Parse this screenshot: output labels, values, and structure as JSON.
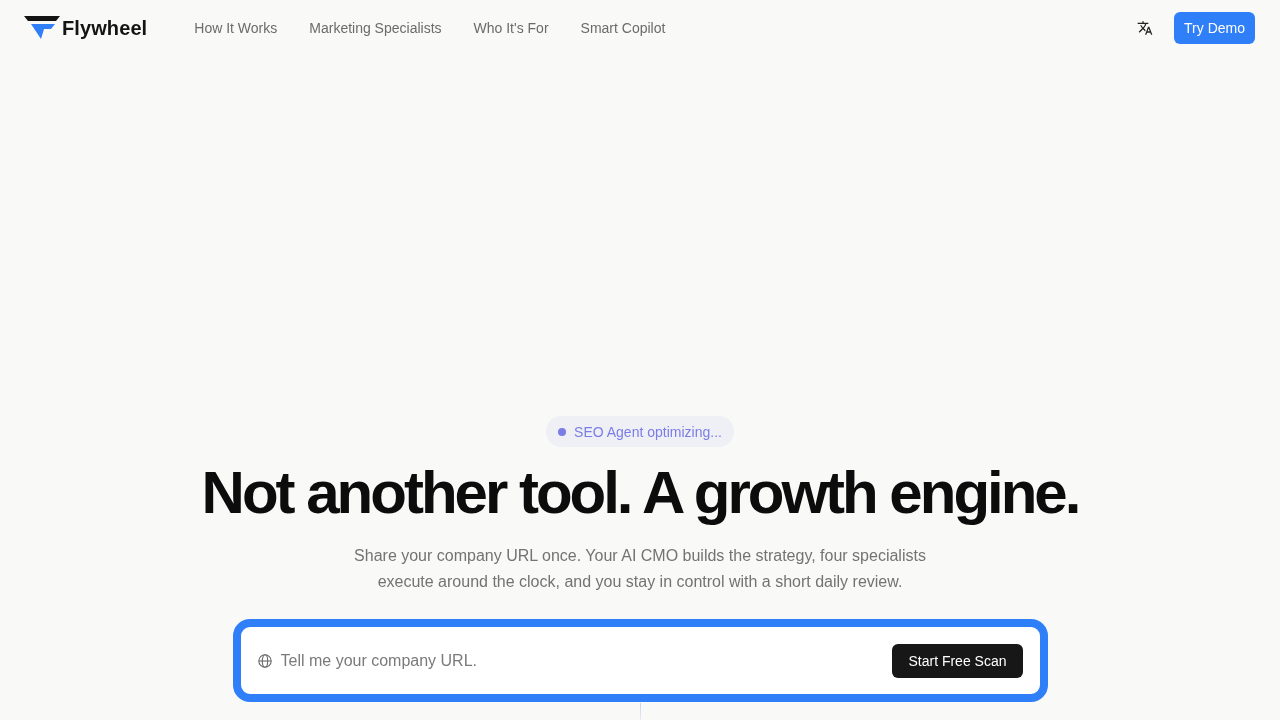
{
  "header": {
    "logo": {
      "text": "Flywheel"
    },
    "nav_links": [
      "How It Works",
      "Marketing Specialists",
      "Who It's For",
      "Smart Copilot"
    ],
    "cta_button": "Try Demo"
  },
  "hero": {
    "status_badge": "SEO Agent optimizing...",
    "headline": "Not another tool. A growth engine.",
    "subheadline": "Share your company URL once. Your AI CMO builds the strategy, four specialists execute around the clock, and you stay in control with a short daily review.",
    "url_form": {
      "placeholder": "Tell me your company URL.",
      "submit_button": "Start Free Scan"
    }
  }
}
